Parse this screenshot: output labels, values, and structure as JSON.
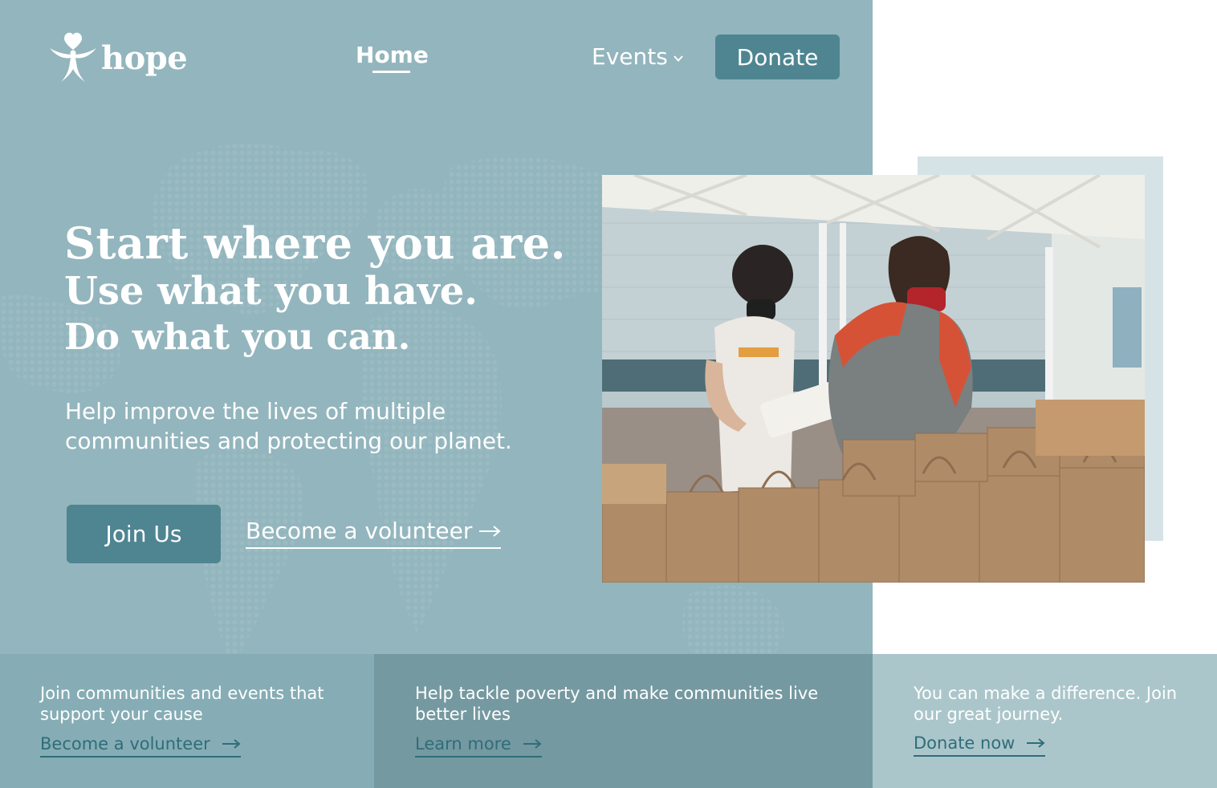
{
  "brand": {
    "name": "hope",
    "logo_icon": "heart-figure-icon"
  },
  "nav": {
    "home_label": "Home",
    "events_label": "Events",
    "donate_label": "Donate"
  },
  "hero": {
    "headline_line1": "Start where you are.",
    "headline_line2": "Use what you have.",
    "headline_line3": "Do what you can.",
    "subtext": "Help improve the lives of multiple communities and protecting our planet.",
    "primary_cta": "Join Us",
    "secondary_cta": "Become a volunteer"
  },
  "cards": [
    {
      "text": "Join communities and events that support your cause",
      "link": "Become a volunteer"
    },
    {
      "text": "Help tackle poverty and make communities live better lives",
      "link": "Learn more"
    },
    {
      "text": "You can make a difference. Join our great journey.",
      "link": "Donate now"
    }
  ],
  "colors": {
    "hero_bg": "#93b5bd",
    "button": "#4e8591",
    "card_1": "#86adb5",
    "card_2": "#7599a1",
    "card_3": "#abc6cb",
    "link_dark": "#2f6d79"
  }
}
